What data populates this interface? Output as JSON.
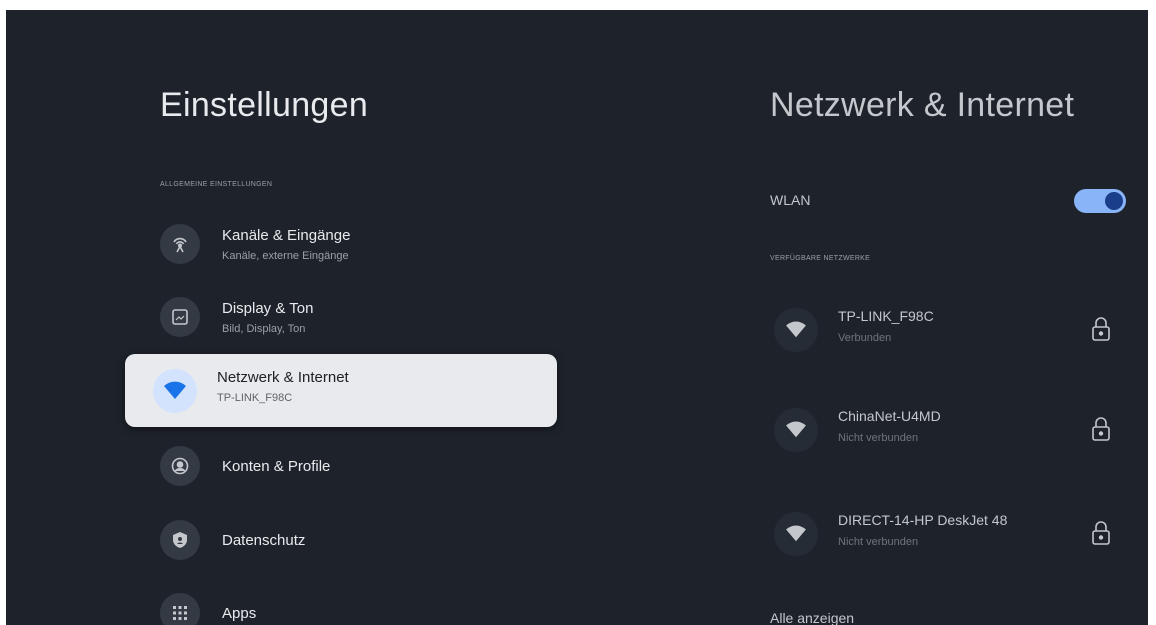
{
  "settings": {
    "title": "Einstellungen",
    "section_label": "ALLGEMEINE EINSTELLUNGEN",
    "items": [
      {
        "label": "Kanäle & Eingänge",
        "subtitle": "Kanäle, externe Eingänge",
        "icon": "antenna-icon"
      },
      {
        "label": "Display & Ton",
        "subtitle": "Bild, Display, Ton",
        "icon": "display-icon"
      },
      {
        "label": "Netzwerk & Internet",
        "subtitle": "TP-LINK_F98C",
        "icon": "wifi-icon"
      },
      {
        "label": "Konten & Profile",
        "icon": "account-icon"
      },
      {
        "label": "Datenschutz",
        "icon": "shield-icon"
      },
      {
        "label": "Apps",
        "icon": "apps-grid-icon"
      }
    ],
    "selected_index": 2
  },
  "network": {
    "title": "Netzwerk & Internet",
    "wlan_label": "WLAN",
    "wlan_enabled": true,
    "available_label": "VERFÜGBARE NETZWERKE",
    "networks": [
      {
        "name": "TP-LINK_F98C",
        "status": "Verbunden",
        "icon": "wifi-icon",
        "secured": true
      },
      {
        "name": "ChinaNet-U4MD",
        "status": "Nicht verbunden",
        "icon": "wifi-icon",
        "secured": true
      },
      {
        "name": "DIRECT-14-HP DeskJet 48",
        "status": "Nicht verbunden",
        "icon": "wifi-icon",
        "secured": true
      }
    ],
    "show_all": "Alle anzeigen"
  },
  "colors": {
    "background": "#1e232b",
    "selected_card": "#e8eaed",
    "accent": "#8ab4f8",
    "wifi_selected": "#1a73e8"
  }
}
